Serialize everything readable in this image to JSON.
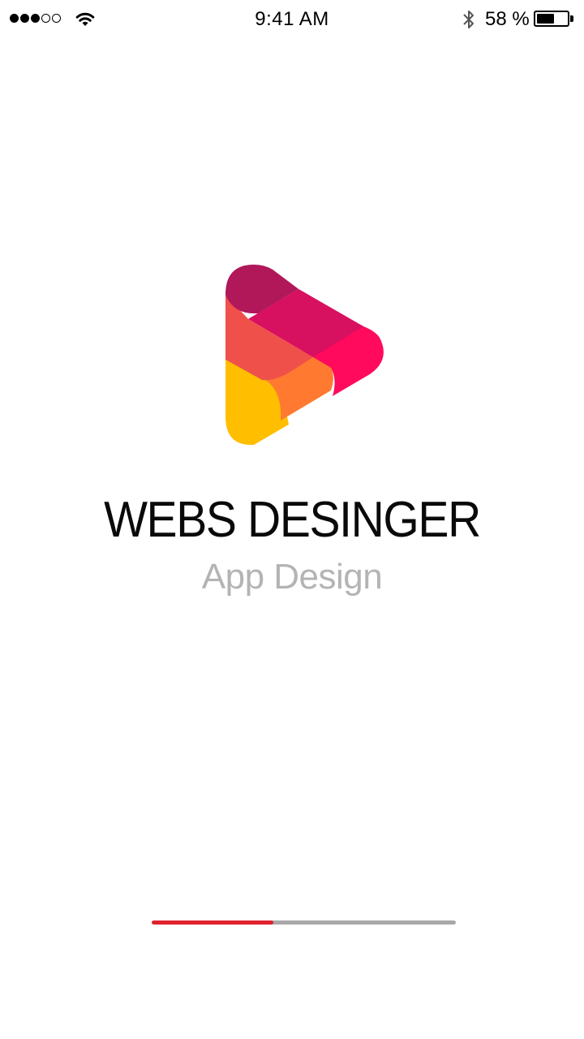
{
  "status_bar": {
    "time": "9:41 AM",
    "battery_text": "58 %",
    "battery_level": 0.58,
    "signal_bars_filled": 3,
    "signal_bars_total": 5,
    "icons": [
      "signal-dots",
      "wifi-icon",
      "bluetooth-icon",
      "battery-icon"
    ]
  },
  "splash": {
    "logo_icon": "play-triangle-logo",
    "title": "WEBS DESINGER",
    "subtitle": "App Design"
  },
  "loading": {
    "progress": 0.4,
    "colors": {
      "fill": "#e0222e",
      "track": "#a8a8a8"
    }
  },
  "logo_colors": {
    "magenta_dark": "#b0185a",
    "magenta": "#d81060",
    "pink": "#ff0a5c",
    "coral": "#f0504a",
    "orange": "#ff7a30",
    "yellow": "#ffbe00"
  }
}
